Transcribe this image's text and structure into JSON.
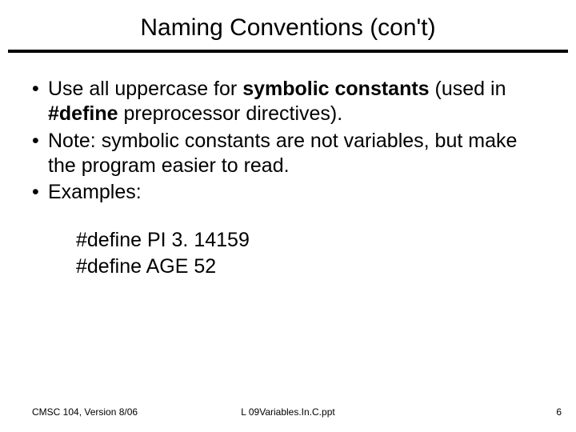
{
  "title": "Naming Conventions (con't)",
  "bullets": {
    "b1": {
      "mark": "•",
      "pre": "Use all uppercase for ",
      "bold1": "symbolic constants",
      "mid1": " (used in ",
      "bold2": "#define",
      "post": " preprocessor directives)."
    },
    "b2": {
      "mark": "•",
      "text": "Note:  symbolic constants are not variables, but make the program easier to read."
    },
    "b3": {
      "mark": "•",
      "text": "Examples:"
    }
  },
  "examples": {
    "line1": "#define PI 3. 14159",
    "line2": "#define AGE  52"
  },
  "footer": {
    "left": "CMSC 104, Version 8/06",
    "center": "L 09Variables.In.C.ppt",
    "right": "6"
  }
}
